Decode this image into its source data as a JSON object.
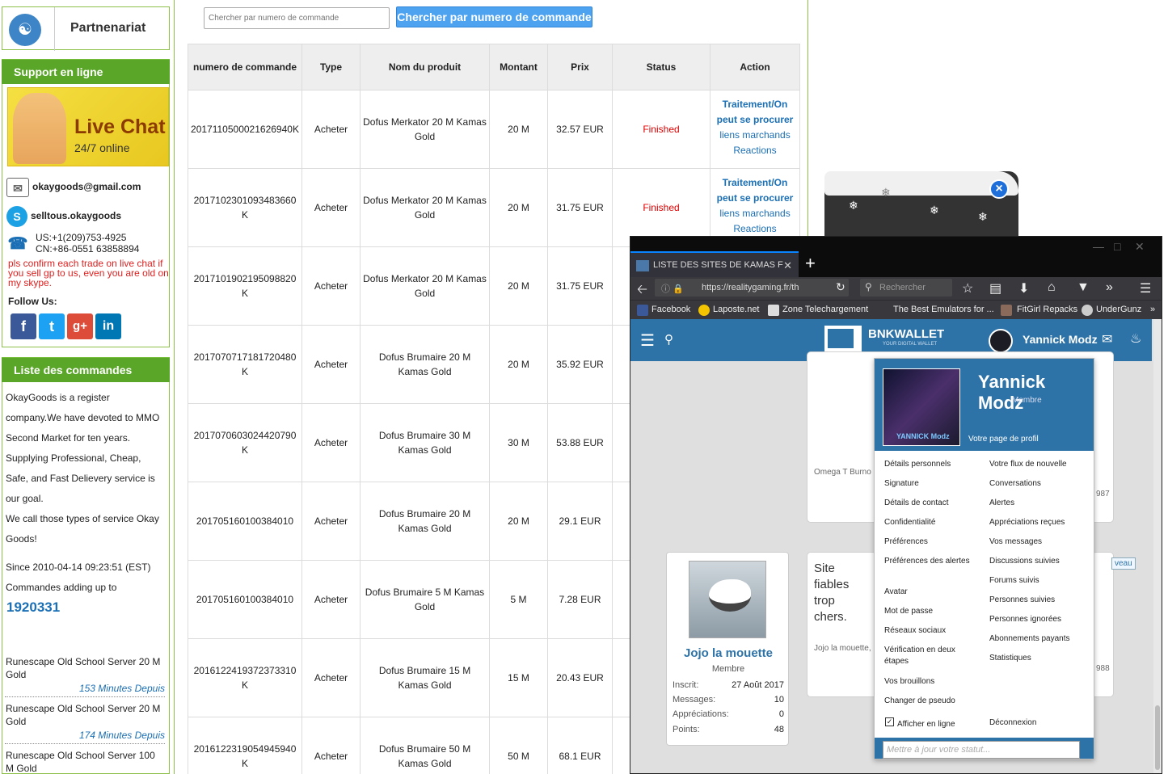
{
  "sidebar": {
    "partner_label": "Partnenariat",
    "support_title": "Support en ligne",
    "livechat_title": "Live Chat",
    "livechat_sub": "24/7 online",
    "email": "okaygoods@gmail.com",
    "skype": "selltous.okaygoods",
    "phone_us": "US:+1(209)753-4925",
    "phone_cn": "CN:+86-0551 63858894",
    "notice": "pls confirm each trade on live chat if you sell gp to us, even you are old on my skype.",
    "follow": "Follow Us:",
    "orders_title": "Liste des commandes",
    "about": [
      "OkayGoods is a register",
      "company.We have devoted to MMO",
      "Second Market for ten years.",
      "Supplying Professional, Cheap,",
      "Safe, and Fast Delievery service is",
      "our goal.",
      "We call those types of service Okay",
      "Goods!"
    ],
    "since": "Since 2010-04-14 09:23:51 (EST)",
    "adding": "Commandes adding up to",
    "count": "1920331",
    "recent": [
      {
        "text": "Runescape Old School Server 20 M Gold",
        "meta": "153  Minutes  Depuis"
      },
      {
        "text": "Runescape Old School Server 20 M Gold",
        "meta": "174  Minutes  Depuis"
      },
      {
        "text": "Runescape Old School Server 100 M Gold",
        "meta": ""
      }
    ]
  },
  "search": {
    "placeholder": "Chercher par numero de commande",
    "button": "Chercher par numero de commande"
  },
  "table": {
    "headers": [
      "numero de commande",
      "Type",
      "Nom du produit",
      "Montant",
      "Prix",
      "Status",
      "Action"
    ],
    "action_main": "Traitement/On peut se procurer",
    "action_links": "liens marchands",
    "action_reactions": "Reactions",
    "rows": [
      {
        "id": "2017110500021626940K",
        "type": "Acheter",
        "product": "Dofus Merkator 20 M Kamas Gold",
        "amount": "20 M",
        "price": "32.57 EUR",
        "status": "Finished"
      },
      {
        "id": "2017102301093483660K",
        "type": "Acheter",
        "product": "Dofus Merkator 20 M Kamas Gold",
        "amount": "20 M",
        "price": "31.75 EUR",
        "status": "Finished"
      },
      {
        "id": "2017101902195098820K",
        "type": "Acheter",
        "product": "Dofus Merkator 20 M Kamas Gold",
        "amount": "20 M",
        "price": "31.75 EUR",
        "status": ""
      },
      {
        "id": "2017070717181720480K",
        "type": "Acheter",
        "product": "Dofus Brumaire 20 M Kamas Gold",
        "amount": "20 M",
        "price": "35.92 EUR",
        "status": ""
      },
      {
        "id": "2017070603024420790K",
        "type": "Acheter",
        "product": "Dofus Brumaire 30 M Kamas Gold",
        "amount": "30 M",
        "price": "53.88 EUR",
        "status": ""
      },
      {
        "id": "201705160100384010",
        "type": "Acheter",
        "product": "Dofus Brumaire 20 M Kamas Gold",
        "amount": "20 M",
        "price": "29.1 EUR",
        "status": ""
      },
      {
        "id": "201705160100384010",
        "type": "Acheter",
        "product": "Dofus Brumaire 5 M Kamas Gold",
        "amount": "5 M",
        "price": "7.28 EUR",
        "status": ""
      },
      {
        "id": "2016122419372373310K",
        "type": "Acheter",
        "product": "Dofus Brumaire 15 M Kamas Gold",
        "amount": "15 M",
        "price": "20.43 EUR",
        "status": ""
      },
      {
        "id": "2016122319054945940K",
        "type": "Acheter",
        "product": "Dofus Brumaire 50 M Kamas Gold",
        "amount": "50 M",
        "price": "68.1 EUR",
        "status": ""
      }
    ]
  },
  "browser": {
    "tab_title": "LISTE DES SITES DE KAMAS F",
    "url": "https://realitygaming.fr/th",
    "search_placeholder": "Rechercher",
    "bookmarks": [
      "Facebook",
      "Laposte.net",
      "Zone Telechargement",
      "The Best Emulators for ...",
      "FitGirl Repacks",
      "UnderGunz"
    ]
  },
  "site": {
    "logo": "BNKWALLET",
    "logo_sub": "YOUR DIGITAL WALLET",
    "user": "Yannick Modz",
    "post_author_1": "Omega T Burno",
    "post_text": "Site fiables trop chers.",
    "post_author_2": "Jojo la mouette,",
    "post_num_1": "987",
    "post_num_2": "988",
    "badge": "veau",
    "card": {
      "name": "Jojo la mouette",
      "role": "Membre",
      "stats": [
        {
          "k": "Inscrit:",
          "v": "27 Août 2017"
        },
        {
          "k": "Messages:",
          "v": "10"
        },
        {
          "k": "Appréciations:",
          "v": "0"
        },
        {
          "k": "Points:",
          "v": "48"
        }
      ]
    },
    "menu": {
      "name": "Yannick Modz",
      "role": "Membre",
      "avatar_tag": "YANNICK Modz",
      "profile_link": "Votre page de profil",
      "left": [
        "Détails personnels",
        "Signature",
        "Détails de contact",
        "Confidentialité",
        "Préférences",
        "Préférences des alertes",
        "Avatar",
        "Mot de passe",
        "Réseaux sociaux",
        "Vérification en deux étapes",
        "Vos brouillons",
        "Changer de pseudo"
      ],
      "right": [
        "Votre flux de nouvelle",
        "Conversations",
        "Alertes",
        "Appréciations reçues",
        "Vos messages",
        "Discussions suivies",
        "Forums suivis",
        "Personnes suivies",
        "Personnes ignorées",
        "Abonnements payants",
        "Statistiques"
      ],
      "show_online": "Afficher en ligne",
      "logout": "Déconnexion",
      "status_placeholder": "Mettre à jour votre statut..."
    }
  },
  "colors": {
    "green": "#5aa628",
    "blue_link": "#1a6fb5",
    "finished": "#e00000",
    "site_blue": "#2d73a8"
  }
}
